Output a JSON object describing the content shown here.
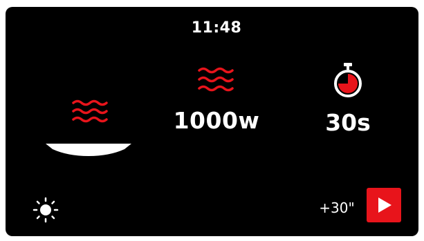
{
  "status_bar": {
    "time": "11:48"
  },
  "mode": {
    "icon": "dish-with-heat-waves-icon"
  },
  "power": {
    "icon": "heat-waves-icon",
    "value": "1000w"
  },
  "timer": {
    "icon": "stopwatch-icon",
    "value": "30s"
  },
  "controls": {
    "brightness_icon": "sun-icon",
    "add_time_label": "+30\"",
    "start_icon": "play-icon"
  },
  "colors": {
    "background": "#000000",
    "accent": "#e8141b",
    "text": "#ffffff"
  }
}
